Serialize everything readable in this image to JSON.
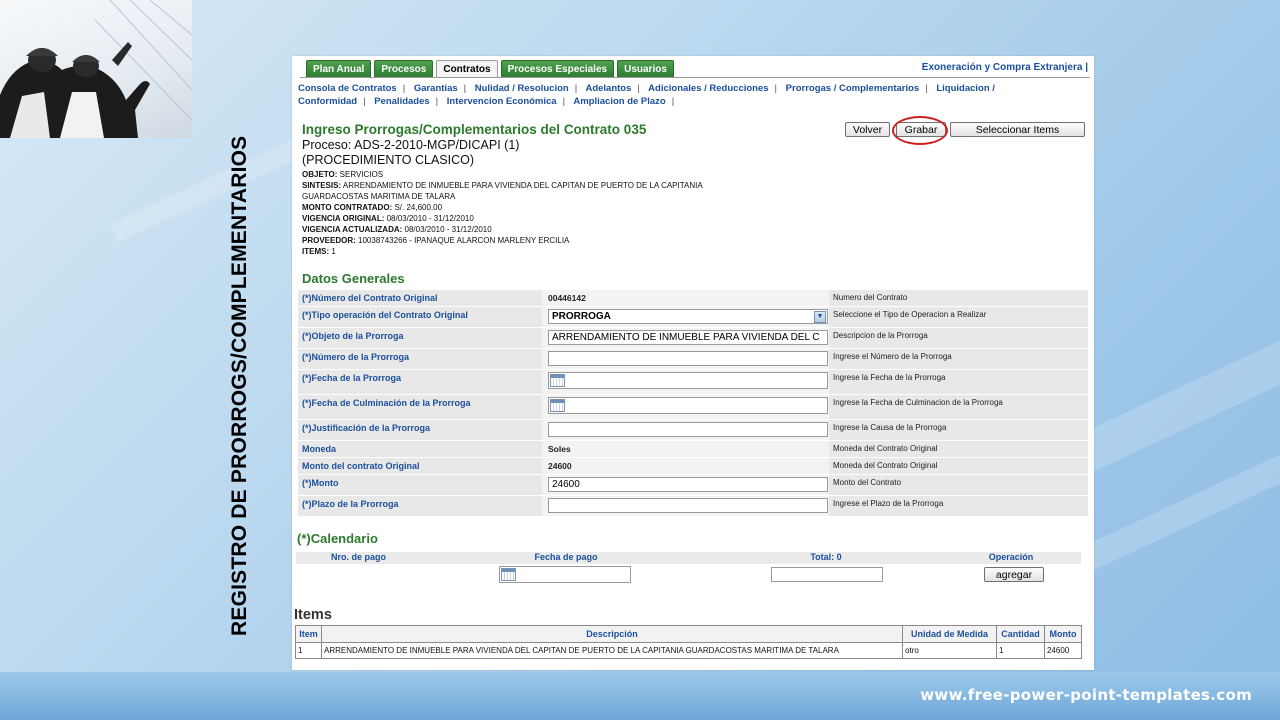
{
  "slide": {
    "vertical_title": "REGISTRO DE PRORROGS/COMPLEMENTARIOS",
    "footer_url": "www.free-power-point-templates.com"
  },
  "tabs": {
    "items": [
      {
        "label": "Plan Anual",
        "active": false
      },
      {
        "label": "Procesos",
        "active": false
      },
      {
        "label": "Contratos",
        "active": true
      },
      {
        "label": "Procesos Especiales",
        "active": false
      },
      {
        "label": "Usuarios",
        "active": false
      }
    ],
    "right_link": "Exoneración y Compra Extranjera |"
  },
  "subnav": [
    "Consola de Contratos",
    "Garantias",
    "Nulidad / Resolucion",
    "Adelantos",
    "Adicionales / Reducciones",
    "Prorrogas / Complementarios",
    "Liquidacion /",
    "Conformidad",
    "Penalidades",
    "Intervencion Económica",
    "Ampliacion de Plazo"
  ],
  "header": {
    "title": "Ingreso Prorrogas/Complementarios del Contrato 035",
    "proceso": "Proceso: ADS-2-2010-MGP/DICAPI (1)",
    "procedimiento": "(PROCEDIMIENTO CLASICO)",
    "buttons": {
      "volver": "Volver",
      "grabar": "Grabar",
      "seleccionar": "Seleccionar Items"
    }
  },
  "meta": [
    {
      "key": "OBJETO:",
      "value": " SERVICIOS"
    },
    {
      "key": "SINTESIS:",
      "value": " ARRENDAMIENTO DE INMUEBLE PARA VIVIENDA DEL CAPITAN DE PUERTO DE LA CAPITANIA"
    },
    {
      "key": "",
      "value": "GUARDACOSTAS MARITIMA DE TALARA"
    },
    {
      "key": "MONTO CONTRATADO:",
      "value": " S/. 24,600.00"
    },
    {
      "key": "VIGENCIA ORIGINAL:",
      "value": " 08/03/2010 - 31/12/2010"
    },
    {
      "key": "VIGENCIA ACTUALIZADA:",
      "value": " 08/03/2010 - 31/12/2010"
    },
    {
      "key": "PROVEEDOR:",
      "value": " 10038743266 - IPANAQUE ALARCON MARLENY ERCILIA"
    },
    {
      "key": "ITEMS:",
      "value": " 1"
    }
  ],
  "datos_generales": {
    "title": "Datos Generales",
    "rows": [
      {
        "label": "(*)Número del Contrato Original",
        "value": "00446142",
        "hint": "Numero del Contrato"
      },
      {
        "label": "(*)Tipo operación del Contrato Original",
        "value": "PRORROGA",
        "hint": "Seleccione el Tipo de Operacion a Realizar"
      },
      {
        "label": "(*)Objeto de la Prorroga",
        "value": "ARRENDAMIENTO DE INMUEBLE PARA VIVIENDA DEL C",
        "hint": "Descripcion de la Prorroga"
      },
      {
        "label": "(*)Número de la Prorroga",
        "value": "",
        "hint": "Ingrese el Número de la Prorroga"
      },
      {
        "label": "(*)Fecha de la Prorroga",
        "value": "",
        "hint": "Ingrese la Fecha de la Prorroga"
      },
      {
        "label": "(*)Fecha de Culminación de la Prorroga",
        "value": "",
        "hint": "Ingrese la Fecha de Culminacion de la Prorroga"
      },
      {
        "label": "(*)Justificación de la Prorroga",
        "value": "",
        "hint": "Ingrese la Causa de la Prorroga"
      },
      {
        "label": "Moneda",
        "value": "Soles",
        "hint": "Moneda del Contrato Original"
      },
      {
        "label": "Monto del contrato Original",
        "value": "24600",
        "hint": "Moneda del Contrato Original"
      },
      {
        "label": "(*)Monto",
        "value": "24600",
        "hint": "Monto del Contrato"
      },
      {
        "label": "(*)Plazo de la Prorroga",
        "value": "",
        "hint": "Ingrese el Plazo de la Prorroga"
      }
    ]
  },
  "calendario": {
    "title": "(*)Calendario",
    "headers": [
      "Nro. de pago",
      "Fecha de pago",
      "Total: 0",
      "Operación"
    ],
    "agregar": "agregar"
  },
  "items": {
    "title": "Items",
    "columns": [
      "Item",
      "Descripción",
      "Unidad de Medida",
      "Cantidad",
      "Monto"
    ],
    "rows": [
      [
        "1",
        "ARRENDAMIENTO DE INMUEBLE PARA VIVIENDA DEL CAPITAN DE PUERTO DE LA CAPITANIA GUARDACOSTAS MARITIMA DE TALARA",
        "otro",
        "1",
        "24600"
      ]
    ]
  }
}
